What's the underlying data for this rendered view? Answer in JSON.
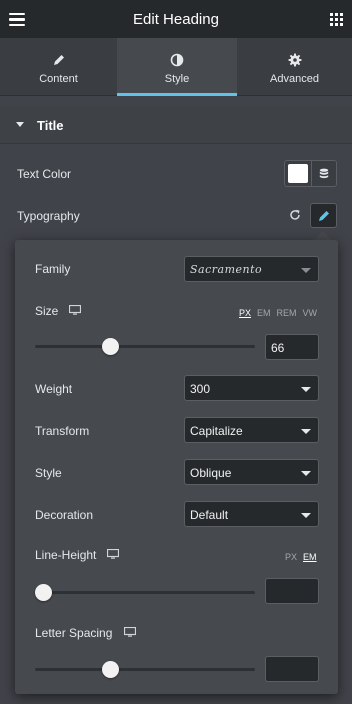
{
  "header": {
    "title": "Edit Heading",
    "menu_icon": "hamburger-icon",
    "apps_icon": "grid-icon"
  },
  "tabs": [
    {
      "label": "Content",
      "icon": "pencil-icon",
      "active": false
    },
    {
      "label": "Style",
      "icon": "half-circle-icon",
      "active": true
    },
    {
      "label": "Advanced",
      "icon": "gear-icon",
      "active": false
    }
  ],
  "accent_color": "#5fc4e8",
  "section": {
    "label": "Title",
    "expanded": true
  },
  "controls": {
    "text_color": {
      "label": "Text Color",
      "value": "#ffffff"
    },
    "typography": {
      "label": "Typography"
    }
  },
  "typography": {
    "family": {
      "label": "Family",
      "value": "Sacramento"
    },
    "size": {
      "label": "Size",
      "units": [
        "PX",
        "EM",
        "REM",
        "VW"
      ],
      "active_unit": "PX",
      "value": "66",
      "slider_fraction": 0.33
    },
    "weight": {
      "label": "Weight",
      "value": "300"
    },
    "transform": {
      "label": "Transform",
      "value": "Capitalize"
    },
    "style": {
      "label": "Style",
      "value": "Oblique"
    },
    "decoration": {
      "label": "Decoration",
      "value": "Default"
    },
    "line_height": {
      "label": "Line-Height",
      "units": [
        "PX",
        "EM"
      ],
      "active_unit": "EM",
      "value": "",
      "slider_fraction": 0.0
    },
    "letter_spacing": {
      "label": "Letter Spacing",
      "value": "",
      "slider_fraction": 0.33
    }
  }
}
